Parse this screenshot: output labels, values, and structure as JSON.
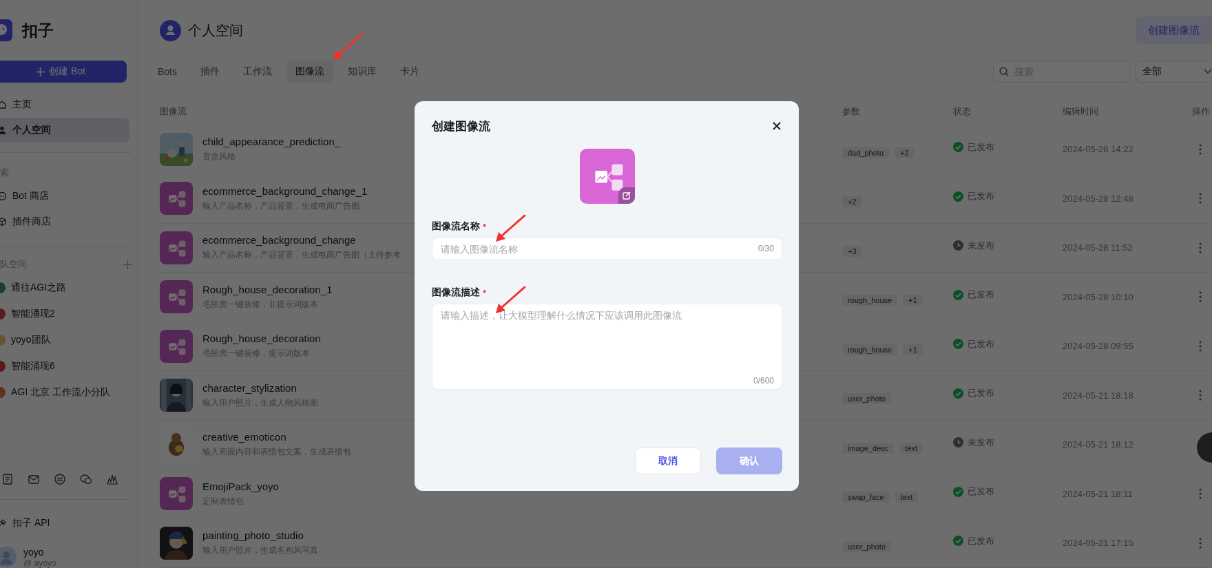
{
  "sidebar": {
    "logo_text": "扣子",
    "create_button": "创建 Bot",
    "nav": [
      {
        "label": "主页",
        "selected": false
      },
      {
        "label": "个人空间",
        "selected": true
      }
    ],
    "explore": {
      "title": "索",
      "items": [
        {
          "label": "Bot 商店"
        },
        {
          "label": "插件商店"
        }
      ]
    },
    "teams": {
      "title": "队空间",
      "items": [
        {
          "label": "通往AGI之路"
        },
        {
          "label": "智能涌现2"
        },
        {
          "label": "yoyo团队"
        },
        {
          "label": "智能涌现6"
        },
        {
          "label": "AGI 北京 工作流小分队"
        }
      ]
    },
    "api_link": "扣子 API",
    "user": {
      "name": "yoyo",
      "handle": "@ ayoyo"
    }
  },
  "header": {
    "title": "个人空间",
    "create_button": "创建图像流"
  },
  "tabs": [
    {
      "label": "Bots",
      "selected": false
    },
    {
      "label": "插件",
      "selected": false
    },
    {
      "label": "工作流",
      "selected": false
    },
    {
      "label": "图像流",
      "selected": true
    },
    {
      "label": "知识库",
      "selected": false
    },
    {
      "label": "卡片",
      "selected": false
    }
  ],
  "search": {
    "placeholder": "搜索"
  },
  "filter": {
    "value": "全部"
  },
  "table": {
    "columns": [
      "图像流",
      "参数",
      "状态",
      "编辑时间",
      "操作"
    ],
    "rows": [
      {
        "kind": "picture",
        "name": "child_appearance_prediction_",
        "description": "盲盒风格",
        "params": [
          "dad_photo",
          "+2"
        ],
        "status": {
          "label": "已发布",
          "published": true
        },
        "edited": "2024-05-28 14:22"
      },
      {
        "kind": "workflow",
        "name": "ecommerce_background_change_1",
        "description": "输入产品名称，产品背景，生成电商广告图",
        "params": [
          "+2"
        ],
        "status": {
          "label": "已发布",
          "published": true
        },
        "edited": "2024-05-28 12:48"
      },
      {
        "kind": "workflow",
        "name": "ecommerce_background_change",
        "description": "输入产品名称，产品背景，生成电商广告图（上传参考",
        "params": [
          "+3"
        ],
        "status": {
          "label": "未发布",
          "published": false
        },
        "edited": "2024-05-28 11:52"
      },
      {
        "kind": "workflow",
        "name": "Rough_house_decoration_1",
        "description": "毛胚房一键装修，非提示词版本",
        "params": [
          "rough_house",
          "+1"
        ],
        "status": {
          "label": "已发布",
          "published": true
        },
        "edited": "2024-05-28 10:10"
      },
      {
        "kind": "workflow",
        "name": "Rough_house_decoration",
        "description": "毛胚房一键装修，提示词版本",
        "params": [
          "rough_house",
          "+1"
        ],
        "status": {
          "label": "已发布",
          "published": true
        },
        "edited": "2024-05-28 09:55"
      },
      {
        "kind": "picture",
        "name": "character_stylization",
        "description": "输入用户照片，生成人物风格图",
        "params": [
          "user_photo"
        ],
        "status": {
          "label": "已发布",
          "published": true
        },
        "edited": "2024-05-21 18:18"
      },
      {
        "kind": "picture",
        "name": "creative_emoticon",
        "description": "输入画面内容和表情包文案，生成表情包",
        "params": [
          "image_desc",
          "text"
        ],
        "status": {
          "label": "未发布",
          "published": false
        },
        "edited": "2024-05-21 18:12"
      },
      {
        "kind": "workflow",
        "name": "EmojiPack_yoyo",
        "description": "定制表情包",
        "params": [
          "swap_face",
          "text"
        ],
        "status": {
          "label": "已发布",
          "published": true
        },
        "edited": "2024-05-21 18:11"
      },
      {
        "kind": "picture",
        "name": "painting_photo_studio",
        "description": "输入用户照片，生成名画风写真",
        "params": [
          "user_photo"
        ],
        "status": {
          "label": "已发布",
          "published": true
        },
        "edited": "2024-05-21 17:15"
      }
    ]
  },
  "modal": {
    "title": "创建图像流",
    "fields": [
      {
        "kind": "input",
        "label": "图像流名称",
        "required_mark": "*",
        "placeholder": "请输入图像流名称",
        "counter": "0/30"
      },
      {
        "kind": "textarea",
        "label": "图像流描述",
        "required_mark": "*",
        "placeholder": "请输入描述，让大模型理解什么情况下应该调用此图像流",
        "counter": "0/600"
      }
    ],
    "buttons": [
      {
        "label": "取消",
        "primary": false,
        "disabled": false
      },
      {
        "label": "确认",
        "primary": true,
        "disabled": true
      }
    ]
  }
}
